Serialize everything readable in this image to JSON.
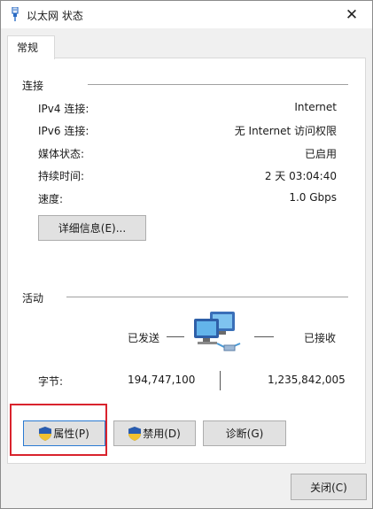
{
  "window": {
    "title": "以太网 状态",
    "close_symbol": "✕"
  },
  "tabs": [
    {
      "label": "常规"
    }
  ],
  "connection": {
    "heading": "连接",
    "rows": [
      {
        "label": "IPv4 连接:",
        "value": "Internet"
      },
      {
        "label": "IPv6 连接:",
        "value": "无 Internet 访问权限"
      },
      {
        "label": "媒体状态:",
        "value": "已启用"
      },
      {
        "label": "持续时间:",
        "value": "2 天 03:04:40"
      },
      {
        "label": "速度:",
        "value": "1.0 Gbps"
      }
    ],
    "details_button": "详细信息(E)..."
  },
  "activity": {
    "heading": "活动",
    "sent_label": "已发送",
    "received_label": "已接收",
    "bytes_label": "字节:",
    "bytes_sent": "194,747,100",
    "bytes_received": "1,235,842,005"
  },
  "buttons": {
    "properties": "属性(P)",
    "disable": "禁用(D)",
    "diagnose": "诊断(G)",
    "close": "关闭(C)"
  },
  "icons": {
    "title": "ethernet-plug-icon",
    "network": "network-computers-icon",
    "shield": "uac-shield-icon"
  },
  "colors": {
    "highlight": "#d9232d",
    "shield_blue": "#2a5db0",
    "shield_yellow": "#f2c230"
  }
}
